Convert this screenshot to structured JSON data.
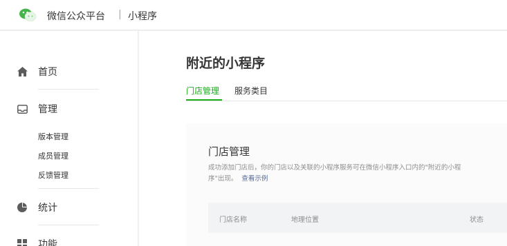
{
  "header": {
    "logo_icon": "wechat-logo-icon",
    "platform_name": "微信公众平台",
    "separator": "|",
    "product_name": "小程序"
  },
  "sidebar": {
    "items": [
      {
        "label": "首页",
        "icon": "home-icon"
      },
      {
        "label": "管理",
        "icon": "inbox-icon",
        "children": [
          "版本管理",
          "成员管理",
          "反馈管理"
        ]
      },
      {
        "label": "统计",
        "icon": "pie-chart-icon"
      },
      {
        "label": "功能",
        "icon": "grid-icon"
      }
    ]
  },
  "main": {
    "title": "附近的小程序",
    "tabs": [
      {
        "label": "门店管理",
        "active": true
      },
      {
        "label": "服务类目",
        "active": false
      }
    ],
    "card": {
      "title": "门店管理",
      "description": "成功添加门店后，你的门店以及关联的小程序服务可在微信小程序入口内的\"附近的小程序\"出现。",
      "link_text": "查看示例",
      "table_headers": [
        "门店名称",
        "地理位置",
        "状态"
      ]
    }
  },
  "colors": {
    "accent": "#1aad19",
    "link": "#576b95",
    "text": "#353535",
    "muted": "#8d8d8d"
  }
}
